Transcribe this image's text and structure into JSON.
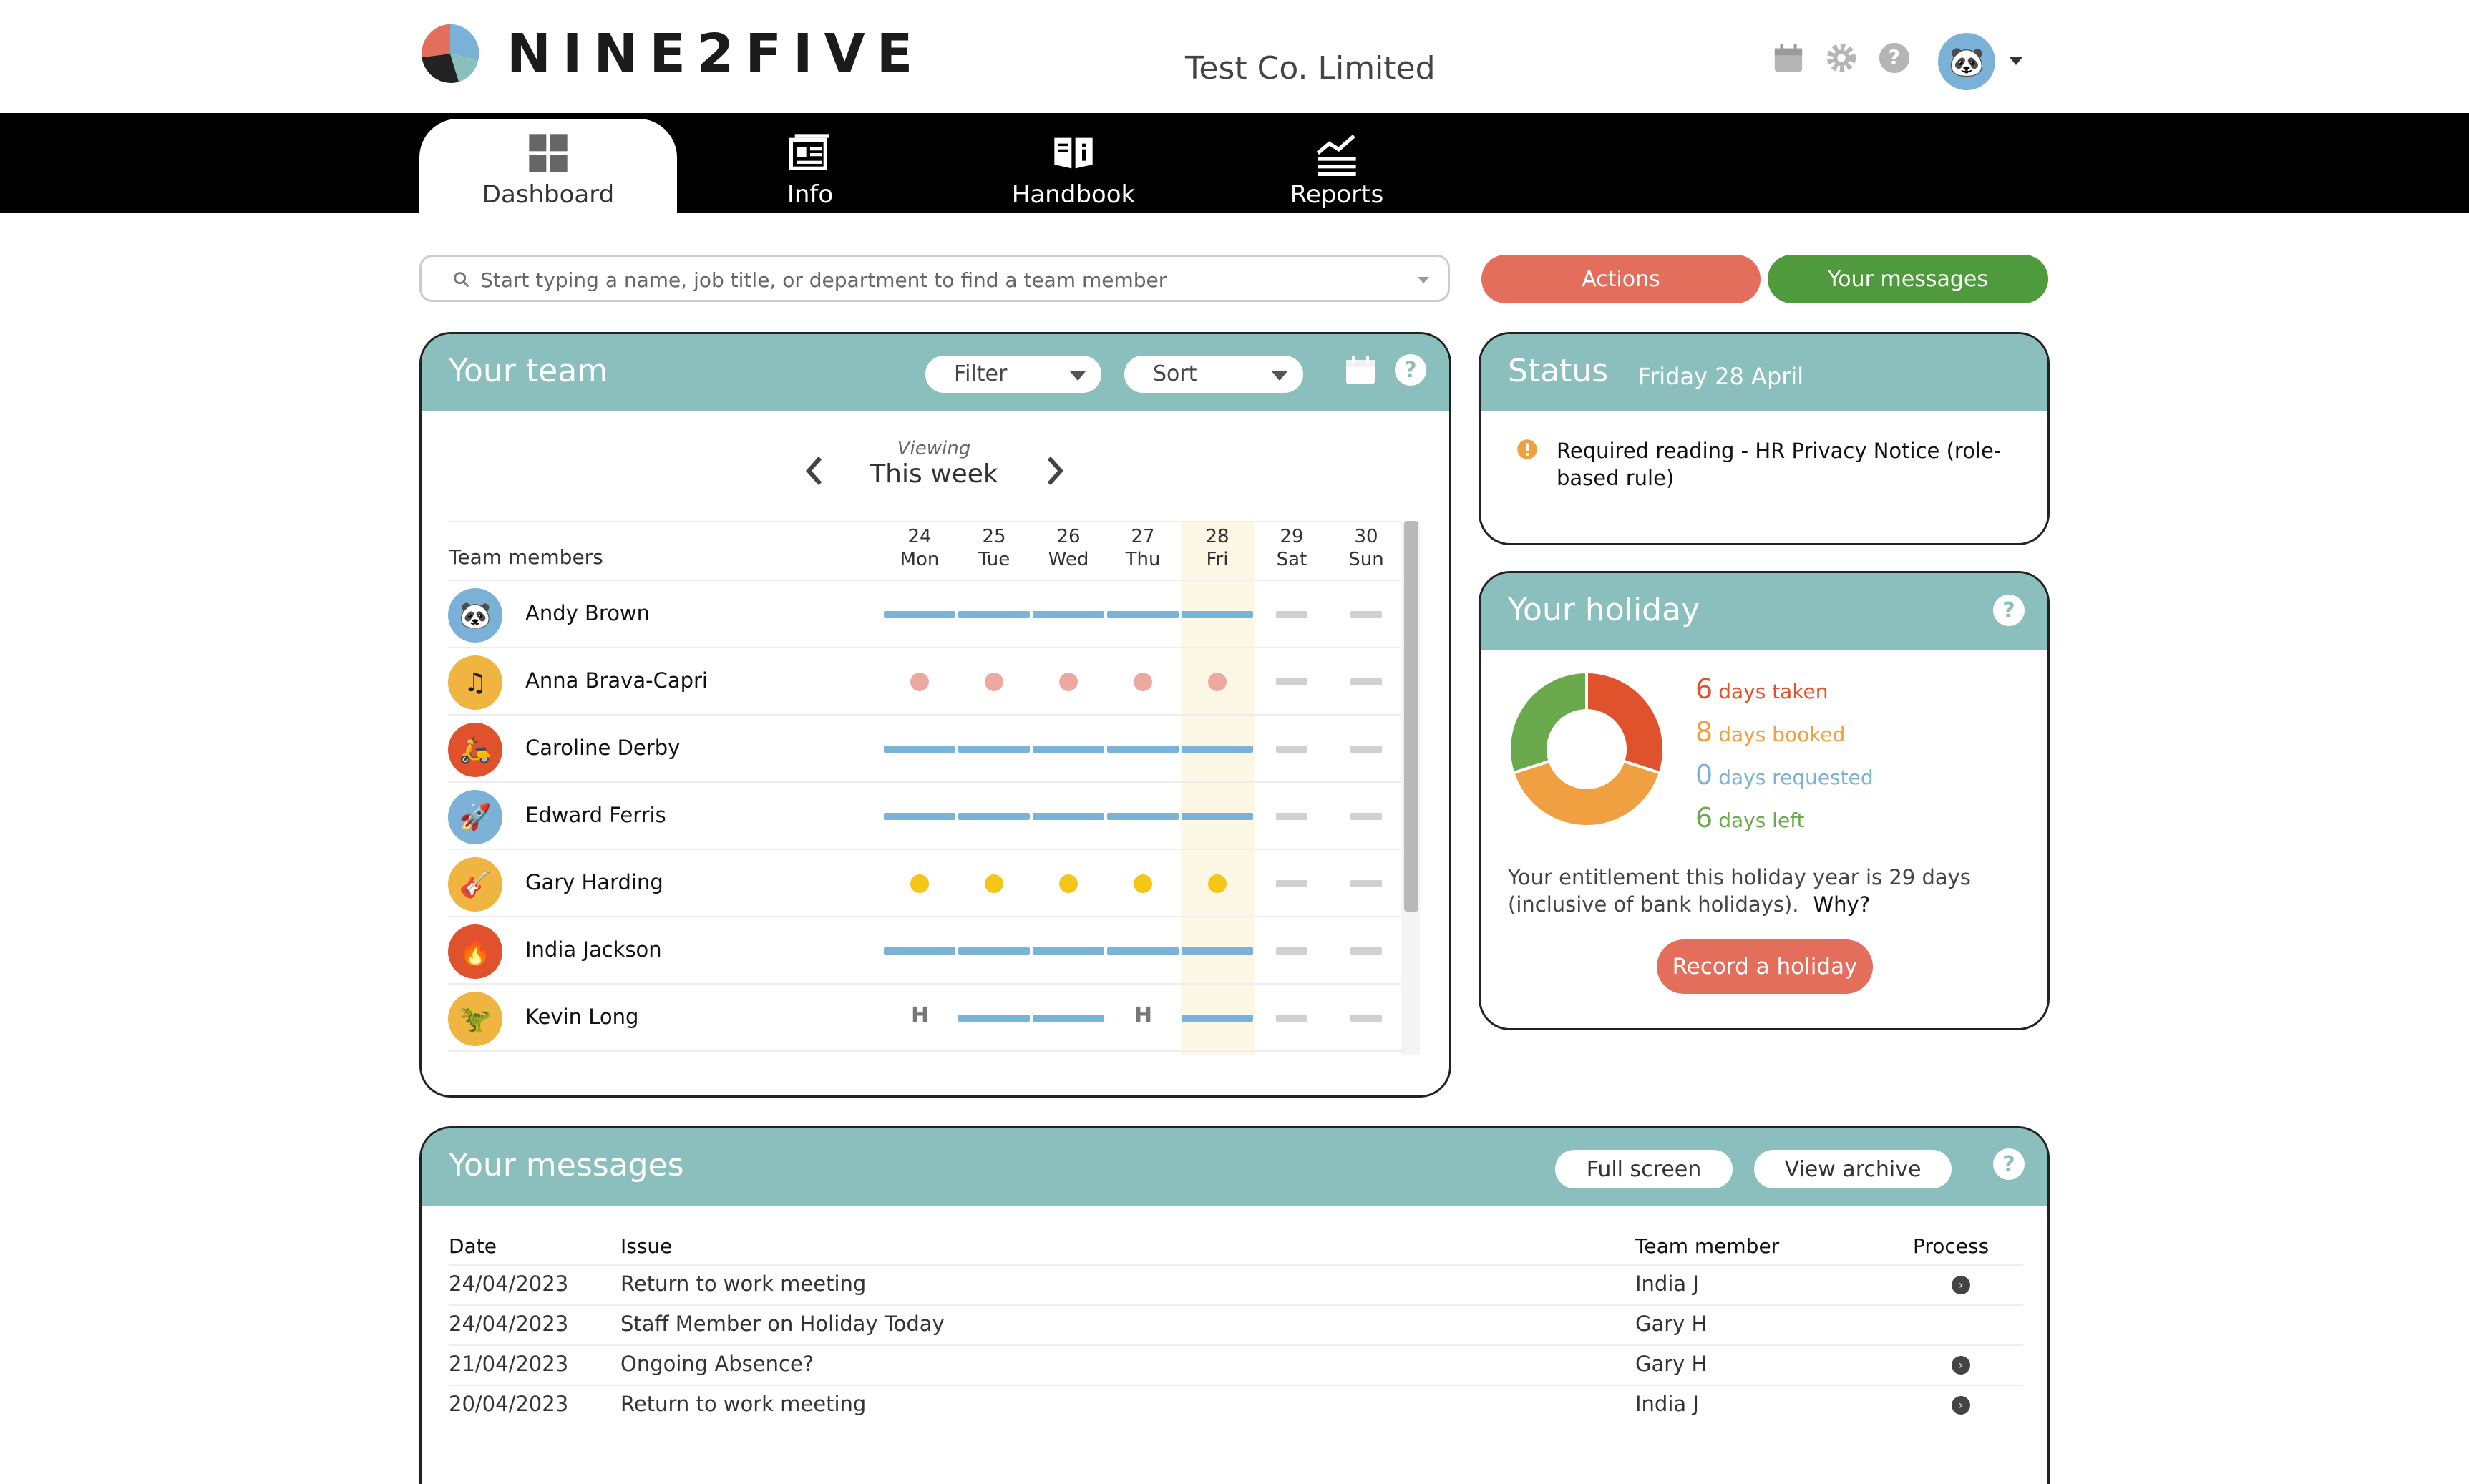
{
  "header": {
    "brand": "NINE2FIVE",
    "company": "Test Co. Limited",
    "icons": [
      "calendar-icon",
      "gear-icon",
      "help-icon"
    ]
  },
  "nav": {
    "tabs": [
      {
        "label": "Dashboard",
        "icon": "dashboard-grid-icon",
        "active": true
      },
      {
        "label": "Info",
        "icon": "info-card-icon",
        "active": false
      },
      {
        "label": "Handbook",
        "icon": "handbook-icon",
        "active": false
      },
      {
        "label": "Reports",
        "icon": "reports-chart-icon",
        "active": false
      }
    ]
  },
  "search": {
    "placeholder": "Start typing a name, job title, or department to find a team member"
  },
  "actions": {
    "actions_label": "Actions",
    "messages_label": "Your messages",
    "actions_color": "#e46e5c",
    "messages_color": "#4e9a3c"
  },
  "team": {
    "title": "Your team",
    "filter_label": "Filter",
    "sort_label": "Sort",
    "viewing_label": "Viewing",
    "viewing_value": "This week",
    "members_header": "Team members",
    "days": [
      {
        "num": "24",
        "name": "Mon"
      },
      {
        "num": "25",
        "name": "Tue"
      },
      {
        "num": "26",
        "name": "Wed"
      },
      {
        "num": "27",
        "name": "Thu"
      },
      {
        "num": "28",
        "name": "Fri"
      },
      {
        "num": "29",
        "name": "Sat"
      },
      {
        "num": "30",
        "name": "Sun"
      }
    ],
    "members": [
      {
        "name": "Andy Brown",
        "avatar_icon": "panda-icon",
        "avatar_color": "#7bb1d6"
      },
      {
        "name": "Anna Brava-Capri",
        "avatar_icon": "music-note-icon",
        "avatar_color": "#f0b440"
      },
      {
        "name": "Caroline Derby",
        "avatar_icon": "scooter-icon",
        "avatar_color": "#e0522c"
      },
      {
        "name": "Edward Ferris",
        "avatar_icon": "rocket-icon",
        "avatar_color": "#7bb1d6"
      },
      {
        "name": "Gary Harding",
        "avatar_icon": "guitar-icon",
        "avatar_color": "#f0b440"
      },
      {
        "name": "India Jackson",
        "avatar_icon": "flame-icon",
        "avatar_color": "#e0522c"
      },
      {
        "name": "Kevin Long",
        "avatar_icon": "dinosaur-icon",
        "avatar_color": "#f0b440"
      }
    ],
    "holiday_marker": "H",
    "colors": {
      "working": "#7ab2d8",
      "pending": "#eda9a0",
      "booked": "#f5c518",
      "weekend": "#d0d0d0"
    }
  },
  "status": {
    "title": "Status",
    "date": "Friday 28 April",
    "items": [
      "Required reading - HR Privacy Notice (role-based rule)"
    ]
  },
  "holiday": {
    "title": "Your holiday",
    "stats": [
      {
        "num": "6",
        "label": "days taken",
        "color": "#e0522c"
      },
      {
        "num": "8",
        "label": "days booked",
        "color": "#f0a040"
      },
      {
        "num": "0",
        "label": "days requested",
        "color": "#7ab2d8"
      },
      {
        "num": "6",
        "label": "days left",
        "color": "#6aaa4c"
      }
    ],
    "entitlement": "Your entitlement this holiday year is 29 days (inclusive of bank holidays).",
    "why_label": "Why?",
    "record_label": "Record a holiday"
  },
  "messages": {
    "title": "Your messages",
    "full_screen_label": "Full screen",
    "archive_label": "View archive",
    "columns": {
      "date": "Date",
      "issue": "Issue",
      "member": "Team member",
      "process": "Process"
    },
    "rows": [
      {
        "date": "24/04/2023",
        "issue": "Return to work meeting",
        "member": "India J",
        "process": true
      },
      {
        "date": "24/04/2023",
        "issue": "Staff Member on Holiday Today",
        "member": "Gary H",
        "process": false
      },
      {
        "date": "21/04/2023",
        "issue": "Ongoing Absence?",
        "member": "Gary H",
        "process": true
      },
      {
        "date": "20/04/2023",
        "issue": "Return to work meeting",
        "member": "India J",
        "process": true
      }
    ]
  }
}
